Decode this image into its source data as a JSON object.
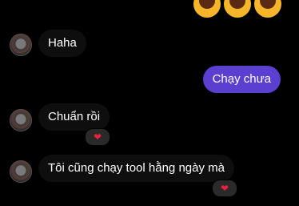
{
  "top_emojis": [
    "face-with-tears-of-joy",
    "face-with-tears-of-joy",
    "face-with-tears-of-joy"
  ],
  "messages": [
    {
      "side": "in",
      "text": "Haha"
    },
    {
      "side": "out",
      "text": "Chạy chưa"
    },
    {
      "side": "in",
      "text": "Chuẩn rồi",
      "reaction": "❤"
    },
    {
      "side": "in",
      "text": "Tôi cũng chạy tool hằng ngày mà",
      "reaction": "❤"
    }
  ],
  "colors": {
    "background": "#000000",
    "incoming_bubble": "#0e0e0e",
    "outgoing_bubble": "#5a3fd0",
    "reaction_heart": "#e8213f"
  }
}
